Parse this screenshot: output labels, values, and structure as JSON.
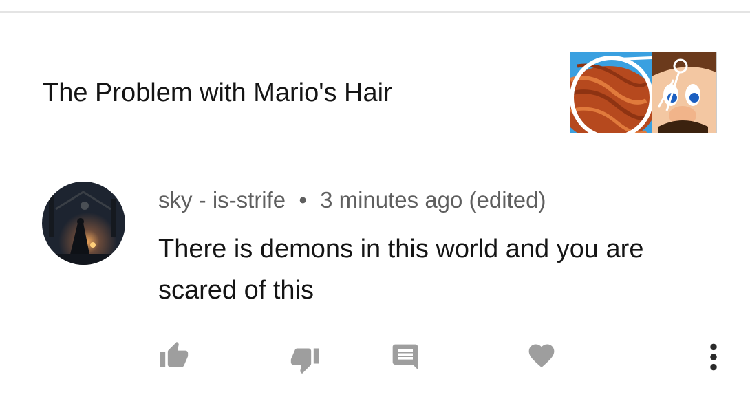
{
  "video": {
    "title": "The Problem with Mario's Hair",
    "thumbnail_icon": "video-thumbnail-hair-mario"
  },
  "comment": {
    "author": "sky - is-strife",
    "separator": "•",
    "time": "3 minutes ago (edited)",
    "text": "There is demons in this world and you are scared of this",
    "avatar_icon": "user-avatar-dark-fantasy"
  },
  "actions": [
    {
      "name": "like",
      "icon": "thumbs-up-icon"
    },
    {
      "name": "dislike",
      "icon": "thumbs-down-icon"
    },
    {
      "name": "reply",
      "icon": "comment-icon"
    },
    {
      "name": "heart",
      "icon": "heart-icon"
    },
    {
      "name": "more",
      "icon": "more-vertical-icon"
    }
  ],
  "colors": {
    "icon_gray": "#9e9e9e",
    "meta_gray": "#5f5f5f",
    "text_dark": "#141414",
    "divider": "#e4e4e4"
  }
}
